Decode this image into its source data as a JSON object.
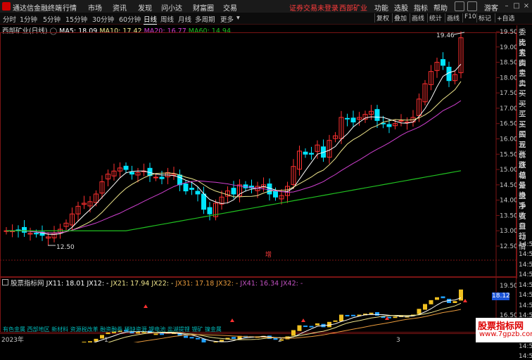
{
  "menubar": {
    "app_name": "通达信金融终端",
    "items": [
      "行情",
      "市场",
      "资讯",
      "发现",
      "问小达",
      "财富圈",
      "交易"
    ],
    "login_link": "证券交易未登录",
    "stock_link": "西部矿业",
    "right_items": [
      "功能",
      "选股",
      "指标",
      "帮助"
    ],
    "guest": "游客"
  },
  "toolbar": {
    "periods": [
      "分时",
      "1分钟",
      "5分钟",
      "15分钟",
      "30分钟",
      "60分钟",
      "日线",
      "周线",
      "月线",
      "多周期",
      "更多"
    ],
    "active_period": "日线",
    "right_tools": [
      "复权",
      "叠加",
      "画线",
      "统计",
      "画线",
      "F10",
      "标记",
      "+自选"
    ]
  },
  "main_legend": {
    "title": "西部矿业(日线)",
    "ma5": "MA5: 18.09",
    "ma10": "MA10: 17.42",
    "ma20": "MA20: 16.77",
    "ma60": "MA60: 14.94"
  },
  "annotations": {
    "high_price": "19.46",
    "low_price": "12.50",
    "zeng_badge": "增"
  },
  "main_axis": [
    "19.50",
    "19.00",
    "18.50",
    "18.00",
    "17.50",
    "17.00",
    "16.50",
    "16.00",
    "15.50",
    "15.00",
    "14.50",
    "14.00",
    "13.50",
    "13.00",
    "12.50"
  ],
  "sub_legend": {
    "title": "股票指标网",
    "jx11": "JX11: 18.01",
    "jx12": "JX12: -",
    "jx21": "JX21: 17.94",
    "jx22": "JX22: -",
    "jx31": "JX31: 17.18",
    "jx32": "JX32: -",
    "jx41": "JX41: 16.34",
    "jx42": "JX42: -"
  },
  "sub_axis": [
    "19.50",
    "18.12",
    "16.50",
    "15.50"
  ],
  "sub_bottom_text": "有色金属 西部地区 新材料 资源税改革 融资融券 稀缺资源 锂电池 盐湖提锂 锂矿 镍金属",
  "x_axis": {
    "year": "2023年",
    "months": [
      "1",
      "2",
      "3"
    ]
  },
  "quote_panel": [
    "委比",
    "卖五",
    "卖四",
    "卖三",
    "卖二",
    "卖一",
    "买一",
    "买二",
    "买三",
    "买四",
    "买五",
    "现价",
    "涨跌",
    "涨幅",
    "总量",
    "外盘",
    "换手",
    "净资",
    "收益",
    "自动",
    "行情",
    "14:5",
    "14:5",
    "14:5",
    "14:5",
    "14:5",
    "14:5",
    "14:5",
    "14:5",
    "14:5",
    "14:5",
    "14:5",
    "14:5"
  ],
  "watermark": {
    "line1": "股票指标网",
    "line2": "www.7gpzb.com"
  },
  "colors": {
    "ma5": "#ffffff",
    "ma10": "#f0e68c",
    "ma20": "#d040d0",
    "ma60": "#20c020",
    "up": "#ff3030",
    "down": "#00e5ff",
    "accent": "#ff3c3c"
  }
}
